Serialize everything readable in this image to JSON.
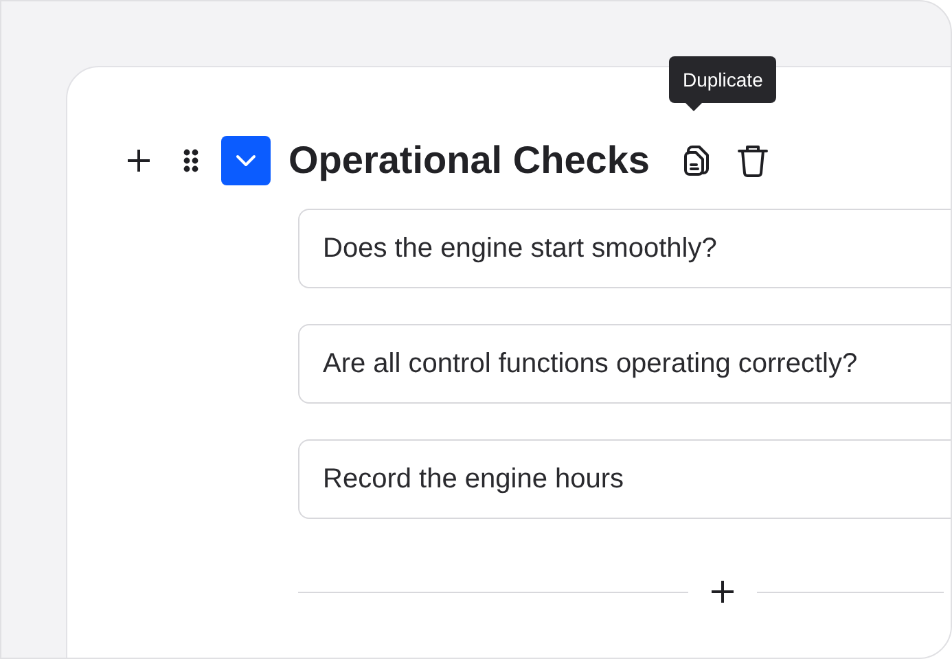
{
  "section": {
    "title": "Operational Checks",
    "expanded": true,
    "tooltip": "Duplicate",
    "questions": [
      {
        "text": "Does the engine start smoothly?"
      },
      {
        "text": "Are all control functions operating correctly?"
      },
      {
        "text": "Record the engine hours"
      }
    ]
  }
}
